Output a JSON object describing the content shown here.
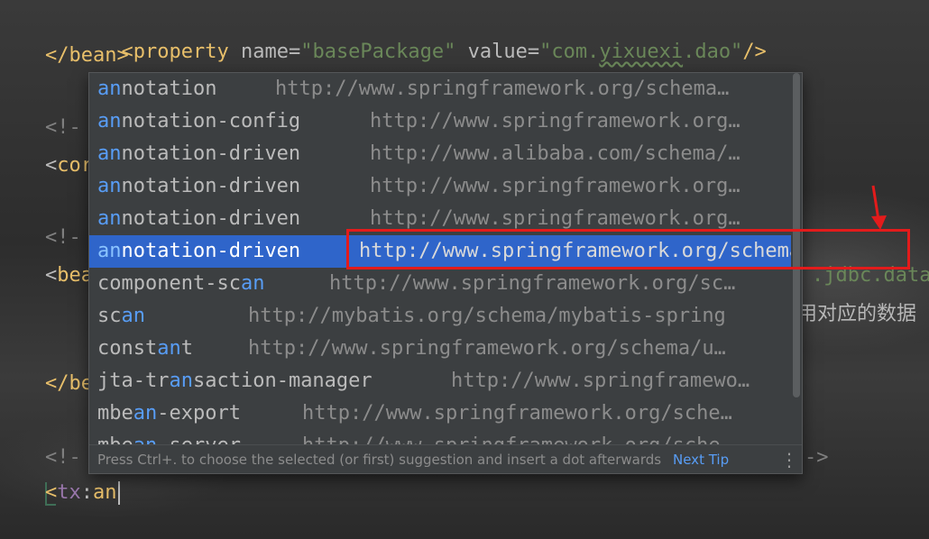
{
  "editor": {
    "line1": {
      "open": "<",
      "tag": "property",
      "attr1": " name",
      "eq1": "=",
      "val1": "\"basePackage\"",
      "attr2": " value",
      "eq2": "=",
      "val2_pre": "\"com.",
      "val2_squiggle": "yixuexi",
      "val2_post": ".dao\"",
      "close": "/>"
    },
    "line2": {
      "text": "</bean>"
    },
    "line4": {
      "text": "<!-"
    },
    "line5": {
      "lt": "<",
      "text": "cor"
    },
    "line7": {
      "text": "<!-"
    },
    "line8": {
      "lt": "<",
      "text": "bea",
      "right": ".jdbc.data"
    },
    "line11": {
      "lt": "</",
      "text": "be"
    },
    "line13": {
      "text": "<!-",
      "right": "->"
    },
    "line14": {
      "open": "<",
      "ns": "tx",
      "colon": ":",
      "typed": "an"
    },
    "bg_cjk": "用对应的数据"
  },
  "completion": {
    "items": [
      {
        "pre": "",
        "match": "an",
        "post": "notation",
        "url": "http://www.springframework.org/schema…"
      },
      {
        "pre": "",
        "match": "an",
        "post": "notation-config",
        "url": "http://www.springframework.org…"
      },
      {
        "pre": "",
        "match": "an",
        "post": "notation-driven",
        "url": "http://www.alibaba.com/schema/…"
      },
      {
        "pre": "",
        "match": "an",
        "post": "notation-driven",
        "url": "http://www.springframework.org…"
      },
      {
        "pre": "",
        "match": "an",
        "post": "notation-driven",
        "url": "http://www.springframework.org…"
      },
      {
        "pre": "",
        "match": "an",
        "post": "notation-driven",
        "url": "http://www.springframework.org/schema/tx",
        "selected": true
      },
      {
        "pre": "component-sc",
        "match": "an",
        "post": "",
        "url": "http://www.springframework.org/sc…"
      },
      {
        "pre": "sc",
        "match": "an",
        "post": "",
        "url": "http://mybatis.org/schema/mybatis-spring"
      },
      {
        "pre": "const",
        "match": "an",
        "post": "t",
        "url": "http://www.springframework.org/schema/u…"
      },
      {
        "pre": "jta-tr",
        "match": "an",
        "post": "saction-manager",
        "url": "http://www.springframewo…"
      },
      {
        "pre": "mbe",
        "match": "an",
        "post": "-export",
        "url": "http://www.springframework.org/sche…"
      },
      {
        "pre": "mbe",
        "match": "an",
        "post": "-server",
        "url": "http://www.springframework.org/sche…"
      }
    ],
    "footer_hint": "Press Ctrl+. to choose the selected (or first) suggestion and insert a dot afterwards",
    "next_tip": "Next Tip",
    "more_icon": "⋮"
  },
  "colors": {
    "selection": "#2f65ca",
    "match": "#589df6",
    "annotation": "#e31b1b"
  }
}
